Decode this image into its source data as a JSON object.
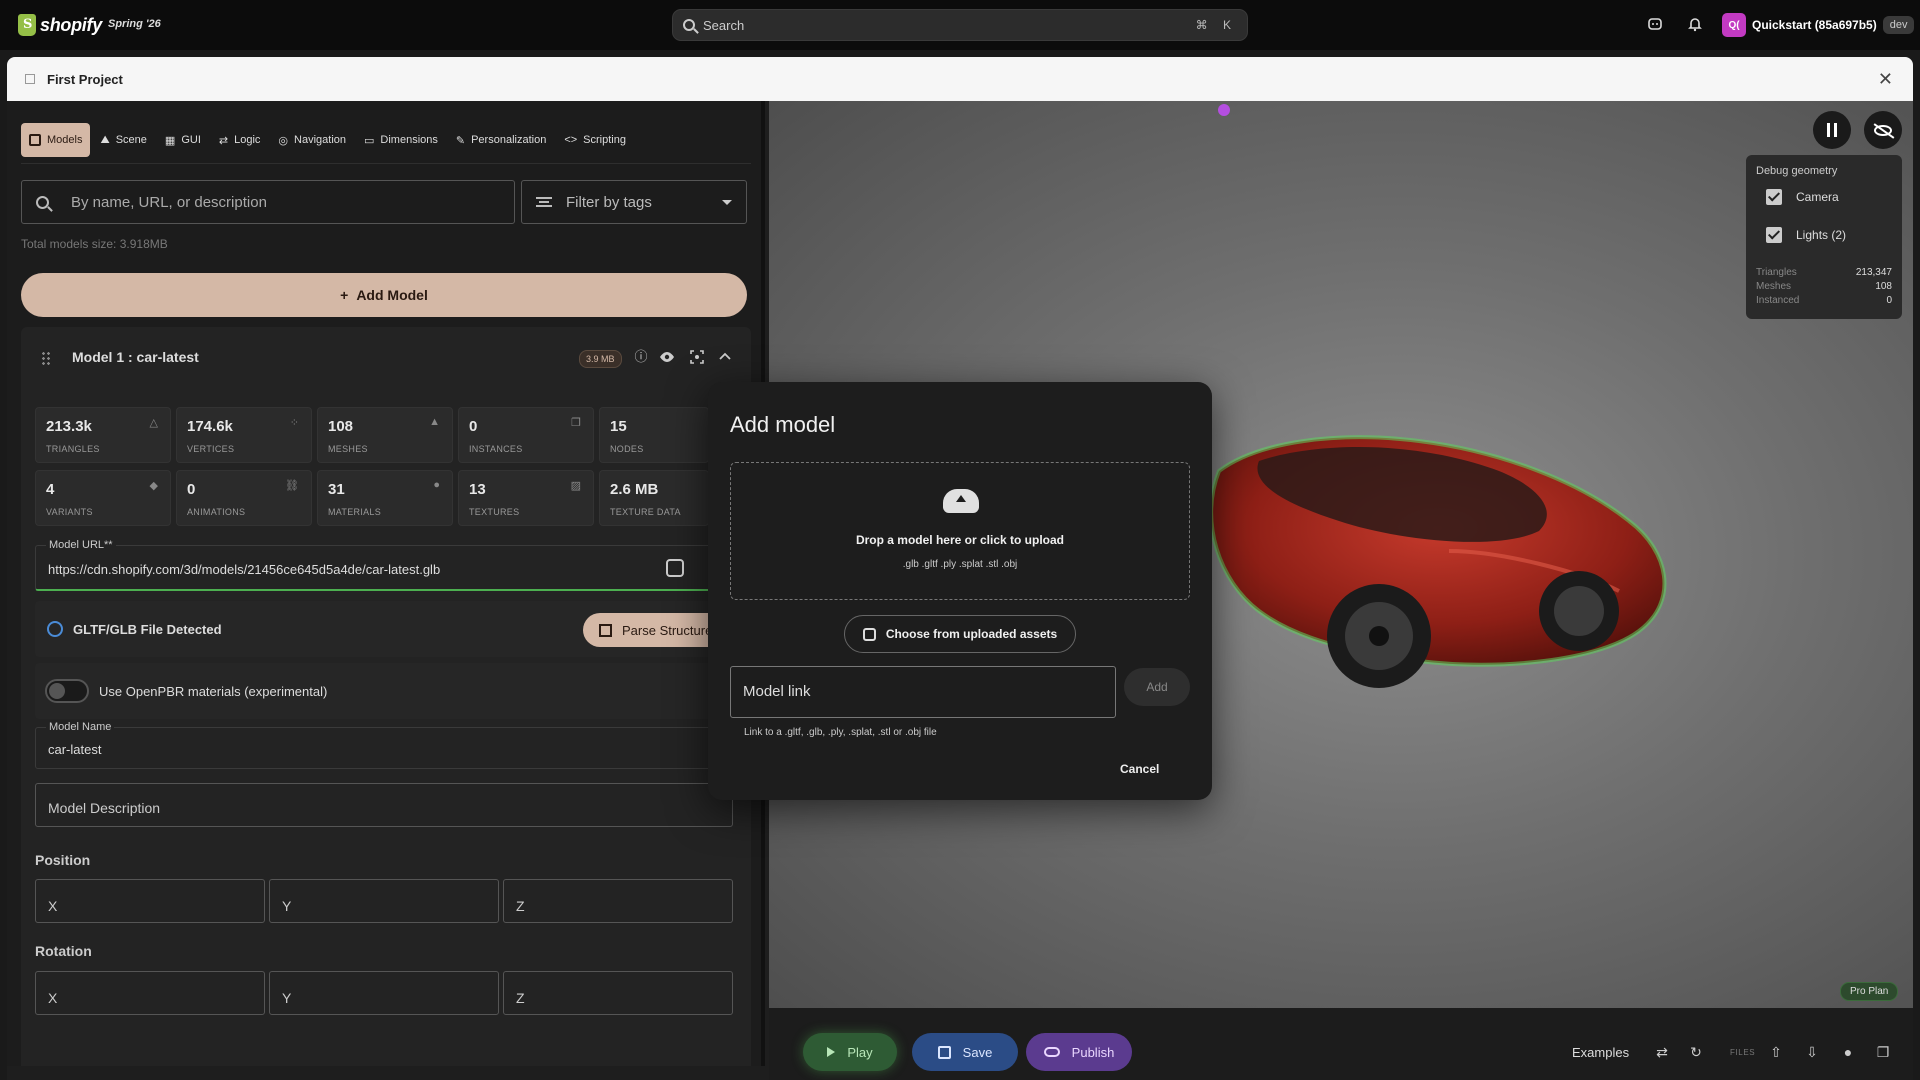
{
  "topbar": {
    "brand": "shopify",
    "edition": "Spring '26",
    "search_placeholder": "Search",
    "search_shortcut": "⌘ K",
    "store_initials": "Q(",
    "store_name": "Quickstart (85a697b5)",
    "store_env": "dev"
  },
  "window": {
    "title": "First Project"
  },
  "tabs": [
    {
      "label": "Models",
      "active": true
    },
    {
      "label": "Scene"
    },
    {
      "label": "GUI"
    },
    {
      "label": "Logic"
    },
    {
      "label": "Navigation"
    },
    {
      "label": "Dimensions"
    },
    {
      "label": "Personalization"
    },
    {
      "label": "Scripting"
    }
  ],
  "models_panel": {
    "search_placeholder": "By name, URL, or description",
    "tag_filter_placeholder": "Filter by tags",
    "total_size": "Total models size: 3.918MB",
    "add_model_label": "Add Model"
  },
  "model": {
    "title": "Model 1 : car-latest",
    "size_badge": "3.9 MB",
    "stats": [
      {
        "value": "213.3k",
        "label": "TRIANGLES"
      },
      {
        "value": "174.6k",
        "label": "VERTICES"
      },
      {
        "value": "108",
        "label": "MESHES"
      },
      {
        "value": "0",
        "label": "INSTANCES"
      },
      {
        "value": "15",
        "label": "NODES"
      },
      {
        "value": "4",
        "label": "VARIANTS"
      },
      {
        "value": "0",
        "label": "ANIMATIONS"
      },
      {
        "value": "31",
        "label": "MATERIALS"
      },
      {
        "value": "13",
        "label": "TEXTURES"
      },
      {
        "value": "2.6 MB",
        "label": "TEXTURE DATA"
      }
    ],
    "url_label": "Model URL**",
    "url_value": "https://cdn.shopify.com/3d/models/21456ce645d5a4de/car-latest.glb",
    "gltf_detected": "GLTF/GLB File Detected",
    "parse_button": "Parse Structure",
    "openpbr_label": "Use OpenPBR materials (experimental)",
    "name_label": "Model Name",
    "name_value": "car-latest",
    "description_placeholder": "Model Description",
    "position_title": "Position",
    "rotation_title": "Rotation",
    "axis_x": "X",
    "axis_y": "Y",
    "axis_z": "Z"
  },
  "debug": {
    "title": "Debug geometry",
    "camera_label": "Camera",
    "lights_label": "Lights (2)",
    "triangles_label": "Triangles",
    "triangles_value": "213,347",
    "meshes_label": "Meshes",
    "meshes_value": "108",
    "instanced_label": "Instanced",
    "instanced_value": "0",
    "plan_badge": "Pro Plan"
  },
  "modal": {
    "title": "Add model",
    "drop_text": "Drop a model here or click to upload",
    "formats": ".glb .gltf .ply .splat .stl .obj",
    "choose_uploaded": "Choose from uploaded assets",
    "link_placeholder": "Model link",
    "add_button": "Add",
    "link_help": "Link to a .gltf, .glb, .ply, .splat, .stl or .obj file",
    "cancel_button": "Cancel"
  },
  "bottombar": {
    "play_label": "Play",
    "save_label": "Save",
    "publish_label": "Publish",
    "examples_label": "Examples",
    "files_label": "FILES"
  },
  "colors": {
    "accent": "#d4b8a6",
    "play": "#2e5b34",
    "save": "#2b4c86",
    "publish": "#5b3b8f",
    "success_underline": "#4caf50"
  }
}
